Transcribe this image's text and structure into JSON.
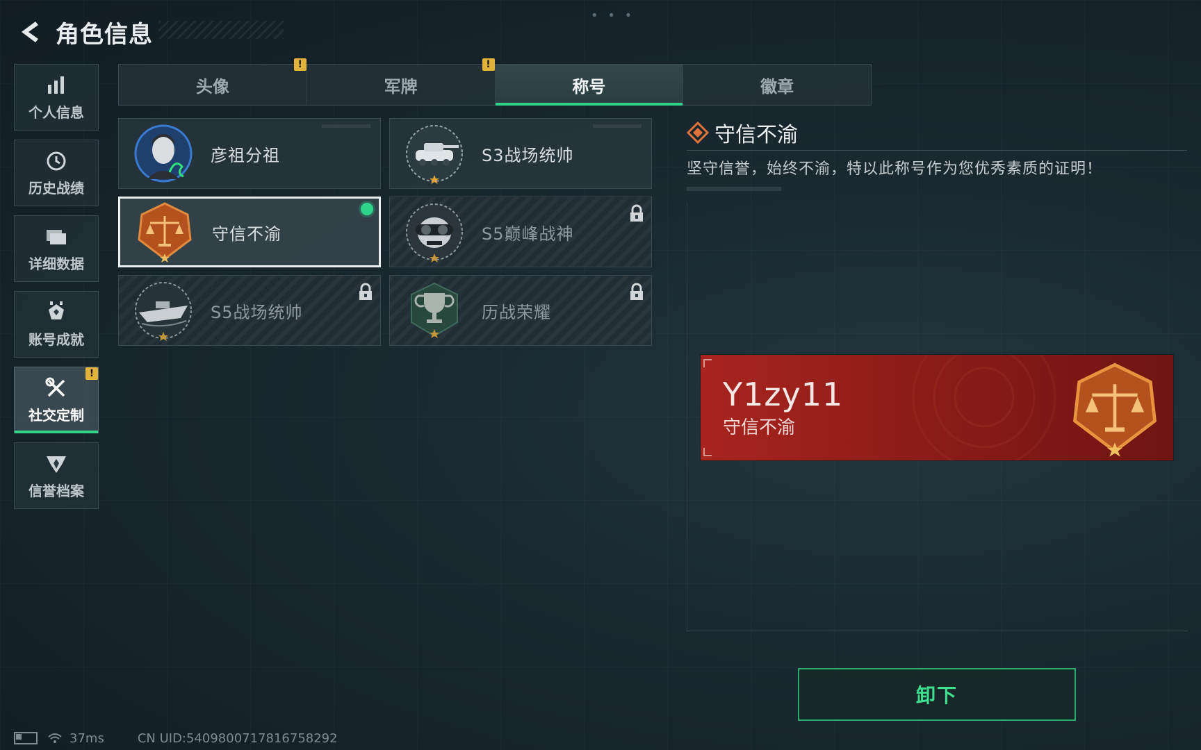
{
  "header": {
    "title": "角色信息"
  },
  "sidebar": {
    "items": [
      {
        "label": "个人信息",
        "icon": "bar-chart-icon"
      },
      {
        "label": "历史战绩",
        "icon": "clock-icon"
      },
      {
        "label": "详细数据",
        "icon": "folder-icon"
      },
      {
        "label": "账号成就",
        "icon": "medal-icon"
      },
      {
        "label": "社交定制",
        "icon": "wrench-screwdriver-icon",
        "active": true,
        "badge": "!"
      },
      {
        "label": "信誉档案",
        "icon": "shield-wing-icon"
      }
    ]
  },
  "tabs": [
    {
      "label": "头像",
      "badge": "!"
    },
    {
      "label": "军牌",
      "badge": "!"
    },
    {
      "label": "称号",
      "active": true
    },
    {
      "label": "徽章"
    }
  ],
  "titles": [
    {
      "name": "彦祖分祖",
      "icon": "portrait-emblem",
      "locked": false
    },
    {
      "name": "S3战场统帅",
      "icon": "tank-emblem",
      "locked": false
    },
    {
      "name": "守信不渝",
      "icon": "scales-emblem",
      "locked": false,
      "selected": true,
      "equipped": true
    },
    {
      "name": "S5巅峰战神",
      "icon": "skull-goggles-emblem",
      "locked": true
    },
    {
      "name": "S5战场统帅",
      "icon": "boat-emblem",
      "locked": true
    },
    {
      "name": "历战荣耀",
      "icon": "trophy-emblem",
      "locked": true
    }
  ],
  "detail": {
    "title": "守信不渝",
    "description": "坚守信誉，始终不渝，特以此称号作为您优秀素质的证明！"
  },
  "banner": {
    "player_name": "Y1zy11",
    "title": "守信不渝"
  },
  "actions": {
    "unequip_label": "卸下"
  },
  "status": {
    "ping": "37ms",
    "uid": "CN UID:5409800717816758292"
  },
  "colors": {
    "accent_green": "#2fd58a",
    "badge_yellow": "#e2b33a",
    "banner_red": "#a8241f",
    "emblem_orange": "#c85a1e"
  }
}
